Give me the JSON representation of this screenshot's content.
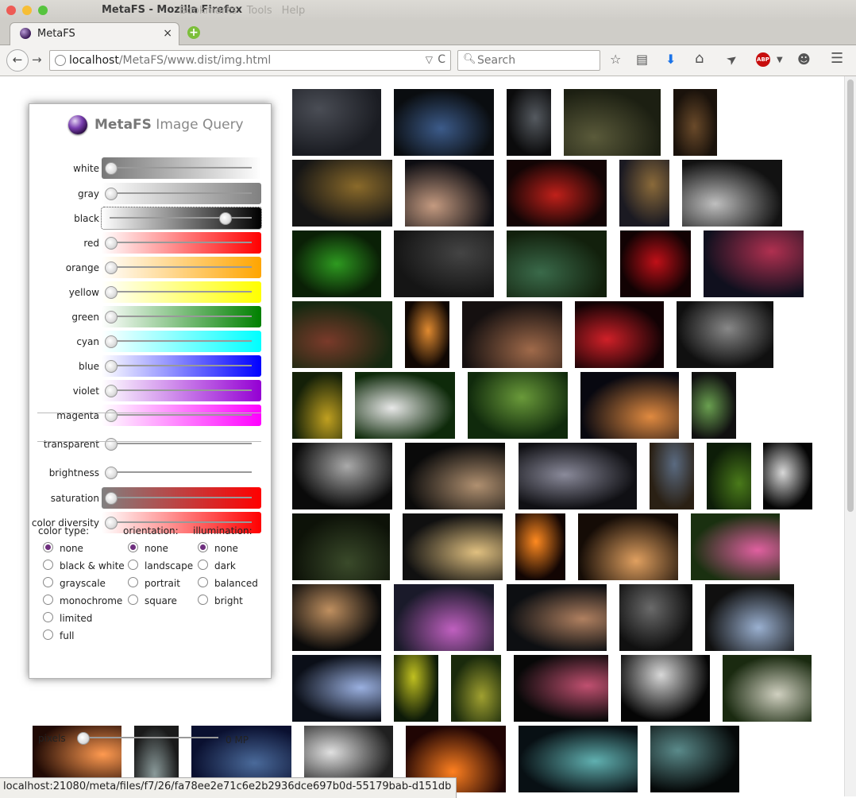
{
  "window": {
    "title": "MetaFS - Mozilla Firefox",
    "menu": [
      "Bookmarks",
      "Tools",
      "Help"
    ],
    "traffic_colors": [
      "#ee5b55",
      "#f6be36",
      "#56c43e"
    ]
  },
  "tab": {
    "label": "MetaFS",
    "close": "×",
    "new_tab": "+"
  },
  "navbar": {
    "url_host": "localhost",
    "url_path": "/MetaFS/www.dist/img.html",
    "search_placeholder": "Search",
    "back_icon": "←",
    "forward_icon": "→",
    "drop_icon": "▽",
    "reload_icon": "C",
    "abp_label": "ABP",
    "toolbar_icons": [
      {
        "name": "bookmark-star-icon",
        "glyph": "☆"
      },
      {
        "name": "reading-list-icon",
        "glyph": "▤"
      },
      {
        "name": "download-icon",
        "glyph": "⬇"
      },
      {
        "name": "home-icon",
        "glyph": "⌂"
      },
      {
        "name": "send-icon",
        "glyph": "➤"
      },
      {
        "name": "chat-icon",
        "glyph": "☻"
      },
      {
        "name": "menu-icon",
        "glyph": "☰"
      }
    ]
  },
  "panel": {
    "title_bold": "MetaFS",
    "title_rest": " Image Query",
    "sliders": [
      {
        "name": "white",
        "label": "white",
        "value": 0,
        "gradient": [
          "#777777",
          "#ffffff"
        ]
      },
      {
        "name": "gray",
        "label": "gray",
        "value": 0,
        "gradient": [
          "#ffffff",
          "#808080"
        ]
      },
      {
        "name": "black",
        "label": "black",
        "value": 0.9,
        "gradient": [
          "#ffffff",
          "#000000"
        ]
      },
      {
        "name": "red",
        "label": "red",
        "value": 0,
        "gradient": [
          "#ffffff",
          "#ff0000"
        ]
      },
      {
        "name": "orange",
        "label": "orange",
        "value": 0,
        "gradient": [
          "#ffffff",
          "#ffa500"
        ]
      },
      {
        "name": "yellow",
        "label": "yellow",
        "value": 0,
        "gradient": [
          "#ffffff",
          "#ffff00"
        ]
      },
      {
        "name": "green",
        "label": "green",
        "value": 0,
        "gradient": [
          "#ffffff",
          "#008000"
        ]
      },
      {
        "name": "cyan",
        "label": "cyan",
        "value": 0,
        "gradient": [
          "#ffffff",
          "#00ffff"
        ]
      },
      {
        "name": "blue",
        "label": "blue",
        "value": 0,
        "gradient": [
          "#ffffff",
          "#0000ff"
        ]
      },
      {
        "name": "violet",
        "label": "violet",
        "value": 0,
        "gradient": [
          "#ffffff",
          "#9400d3"
        ]
      },
      {
        "name": "magenta",
        "label": "magenta",
        "value": 0,
        "gradient": [
          "#ffffff",
          "#ff00ff"
        ]
      },
      {
        "name": "transparent",
        "label": "transparent",
        "value": 0,
        "gradient": null
      },
      {
        "name": "brightness",
        "label": "brightness",
        "value": 0,
        "gradient": null
      },
      {
        "name": "saturation",
        "label": "saturation",
        "value": 0,
        "gradient": [
          "#808080",
          "#ff0000"
        ]
      },
      {
        "name": "color-diversity",
        "label": "color diversity",
        "value": 0,
        "gradient": [
          "#ffffff",
          "#ff0000"
        ]
      }
    ],
    "groups": [
      {
        "name": "color-type",
        "label": "color type:",
        "options": [
          "none",
          "black & white",
          "grayscale",
          "monochrome",
          "limited",
          "full"
        ],
        "selected": 0
      },
      {
        "name": "orientation",
        "label": "orientation:",
        "options": [
          "none",
          "landscape",
          "portrait",
          "square"
        ],
        "selected": 0
      },
      {
        "name": "illumination",
        "label": "illumination:",
        "options": [
          "none",
          "dark",
          "balanced",
          "bright"
        ],
        "selected": 0
      }
    ],
    "pixels_label": "pixels",
    "pixels_value": "0 MP",
    "pixels_level": 0
  },
  "thumbnail_colors": [
    [
      "#4a4d55",
      "#1a1c22"
    ],
    [
      "#3c5b8a",
      "#0a0d10"
    ],
    [
      "#555a60",
      "#0b0b0c"
    ],
    [
      "#5a5a3a",
      "#1c1f12"
    ],
    [
      "#6a4a2a",
      "#1a120b"
    ],
    [
      "#8a6a2a",
      "#151515"
    ],
    [
      "#c49a80",
      "#0d0d12"
    ],
    [
      "#c0201a",
      "#130505"
    ],
    [
      "#8a6a3a",
      "#1b1a22"
    ],
    [
      "#bfbfbf",
      "#121212"
    ],
    [
      "#2e9a20",
      "#0a2006"
    ],
    [
      "#444444",
      "#151515"
    ],
    [
      "#3a6a4a",
      "#12200c"
    ],
    [
      "#c01018",
      "#120203"
    ],
    [
      "#b03050",
      "#10101e"
    ],
    [
      "#7a3a2a",
      "#152810"
    ],
    [
      "#e08a30",
      "#100703"
    ],
    [
      "#a06a4a",
      "#151010"
    ],
    [
      "#d02028",
      "#120204"
    ],
    [
      "#888888",
      "#101010"
    ],
    [
      "#c0a020",
      "#142008"
    ],
    [
      "#e8e8e8",
      "#0e2a0a"
    ],
    [
      "#6a9a3a",
      "#102a0c"
    ],
    [
      "#e08a40",
      "#080810"
    ],
    [
      "#6aa050",
      "#101010"
    ],
    [
      "#aaaaaa",
      "#0a0a0a"
    ],
    [
      "#b09070",
      "#0a0a0a"
    ],
    [
      "#8a8a9a",
      "#101014"
    ],
    [
      "#5a6a80",
      "#2a2014"
    ],
    [
      "#4a7a1a",
      "#0d1d08"
    ],
    [
      "#d8d8d8",
      "#050505"
    ],
    [
      "#3a4a2a",
      "#0d1208"
    ],
    [
      "#e0c080",
      "#101010"
    ],
    [
      "#ff8a20",
      "#120503"
    ],
    [
      "#e0a060",
      "#150c06"
    ],
    [
      "#e060a0",
      "#1a3010"
    ],
    [
      "#c09060",
      "#0a0a0a"
    ],
    [
      "#c060c0",
      "#1a1a2a"
    ],
    [
      "#b08060",
      "#0d0f12"
    ],
    [
      "#6a6a6a",
      "#101010"
    ],
    [
      "#9ab0d0",
      "#101010"
    ],
    [
      "#9ab0e0",
      "#0b0f18"
    ],
    [
      "#c0c020",
      "#0d1a08"
    ],
    [
      "#a0a030",
      "#1a2a0c"
    ],
    [
      "#c05070",
      "#080808"
    ],
    [
      "#d8d8d8",
      "#050505"
    ],
    [
      "#d0d0c0",
      "#1a2a10"
    ],
    [
      "#ff9a50",
      "#200a05"
    ],
    [
      "#8a9a9a",
      "#1a1a1a"
    ],
    [
      "#4a6a9a",
      "#0a1030"
    ],
    [
      "#e0e0e0",
      "#202020"
    ],
    [
      "#ff8020",
      "#200504"
    ],
    [
      "#60b0b0",
      "#081014"
    ],
    [
      "#5a8a8a",
      "#050808"
    ]
  ]
}
